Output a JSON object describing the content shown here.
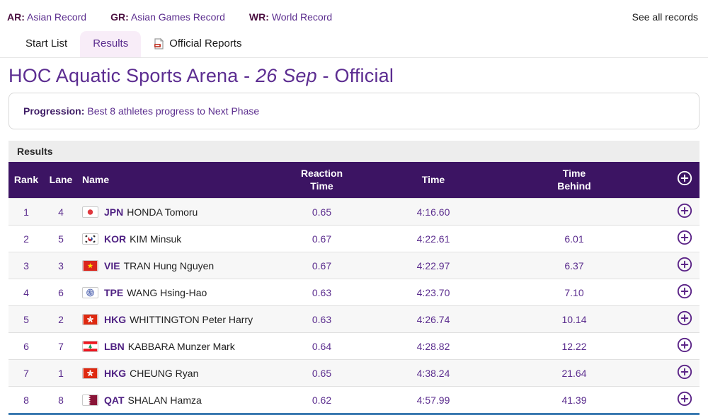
{
  "records_legend": {
    "items": [
      {
        "abbr": "AR:",
        "label": "Asian Record"
      },
      {
        "abbr": "GR:",
        "label": "Asian Games Record"
      },
      {
        "abbr": "WR:",
        "label": "World Record"
      }
    ],
    "see_all": "See all records"
  },
  "tabs": {
    "start_list": "Start List",
    "results": "Results",
    "official_reports": "Official Reports",
    "official_reports_icon": "pdf-document-icon"
  },
  "page_title": {
    "prefix": "HOC Aquatic Sports Arena - ",
    "date": "26 Sep",
    "suffix": " - Official"
  },
  "progression": {
    "label": "Progression:",
    "text": "Best 8 athletes progress to Next Phase"
  },
  "results_section": {
    "title": "Results"
  },
  "table": {
    "headers": {
      "rank": "Rank",
      "lane": "Lane",
      "name": "Name",
      "reaction_l1": "Reaction",
      "reaction_l2": "Time",
      "time": "Time",
      "behind_l1": "Time",
      "behind_l2": "Behind",
      "expand_icon": "plus-circle-icon"
    },
    "rows": [
      {
        "rank": "1",
        "lane": "4",
        "flag": "jpn",
        "noc": "JPN",
        "athlete": "HONDA Tomoru",
        "reaction": "0.65",
        "time": "4:16.60",
        "behind": ""
      },
      {
        "rank": "2",
        "lane": "5",
        "flag": "kor",
        "noc": "KOR",
        "athlete": "KIM Minsuk",
        "reaction": "0.67",
        "time": "4:22.61",
        "behind": "6.01"
      },
      {
        "rank": "3",
        "lane": "3",
        "flag": "vie",
        "noc": "VIE",
        "athlete": "TRAN Hung Nguyen",
        "reaction": "0.67",
        "time": "4:22.97",
        "behind": "6.37"
      },
      {
        "rank": "4",
        "lane": "6",
        "flag": "tpe",
        "noc": "TPE",
        "athlete": "WANG Hsing-Hao",
        "reaction": "0.63",
        "time": "4:23.70",
        "behind": "7.10"
      },
      {
        "rank": "5",
        "lane": "2",
        "flag": "hkg",
        "noc": "HKG",
        "athlete": "WHITTINGTON Peter Harry",
        "reaction": "0.63",
        "time": "4:26.74",
        "behind": "10.14"
      },
      {
        "rank": "6",
        "lane": "7",
        "flag": "lbn",
        "noc": "LBN",
        "athlete": "KABBARA Munzer Mark",
        "reaction": "0.64",
        "time": "4:28.82",
        "behind": "12.22"
      },
      {
        "rank": "7",
        "lane": "1",
        "flag": "hkg",
        "noc": "HKG",
        "athlete": "CHEUNG Ryan",
        "reaction": "0.65",
        "time": "4:38.24",
        "behind": "21.64"
      },
      {
        "rank": "8",
        "lane": "8",
        "flag": "qat",
        "noc": "QAT",
        "athlete": "SHALAN Hamza",
        "reaction": "0.62",
        "time": "4:57.99",
        "behind": "41.39"
      }
    ]
  },
  "colors": {
    "accent_purple": "#5b2d8e",
    "header_purple": "#3c1463",
    "bottom_border_blue": "#3878b0",
    "active_tab_bg": "#f8edf8"
  }
}
